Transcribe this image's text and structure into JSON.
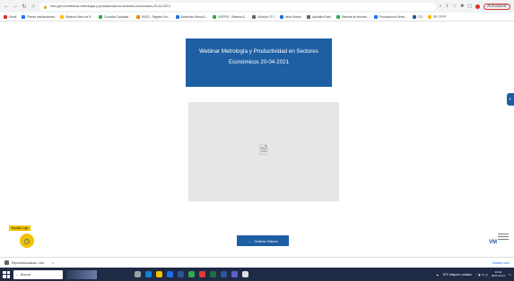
{
  "browser": {
    "url": "lmm.gob.mx/webinar-metrologia-y-productividad-en-sectores-economicos-20-04-2021/",
    "update_label": "Actualizar"
  },
  "bookmarks": [
    {
      "label": "Gmail",
      "color": "#d93025"
    },
    {
      "label": "Planes Institucionales",
      "color": "#1a73e8"
    },
    {
      "label": "Sistema Único de R...",
      "color": "#fbbc04"
    },
    {
      "label": "Consulta Ciudadan...",
      "color": "#34a853"
    },
    {
      "label": "RUES - Registro Úni...",
      "color": "#ea8600"
    },
    {
      "label": "Academia Virtual A...",
      "color": "#1a73e8"
    },
    {
      "label": "SISPRO - Sistema &...",
      "color": "#34a853"
    },
    {
      "label": "Solución TI 2",
      "color": "#5f6368"
    },
    {
      "label": "Inicio Sesión",
      "color": "#1a73e8"
    },
    {
      "label": "Aplicativo Sabi",
      "color": "#5f6368"
    },
    {
      "label": "Sistema de Informa...",
      "color": "#34a853"
    },
    {
      "label": "Procuraduría Gener...",
      "color": "#1a73e8"
    },
    {
      "label": "CCI",
      "color": "#1e5fa3"
    },
    {
      "label": "SP CPYP",
      "color": "#fbbc04"
    }
  ],
  "title": {
    "line1": "Webinar Metrología y Productividad en Sectores",
    "line2": "Económicos 20-04-2021"
  },
  "gallery_button": {
    "arrow": "←",
    "label": "Galeria Videos"
  },
  "survey": {
    "label": "Escribir Logo"
  },
  "logo": {
    "text": "VM"
  },
  "download": {
    "filename": "ReporteActualizac...xlsx",
    "show_all": "Mostrar todo"
  },
  "taskbar": {
    "search_placeholder": "Buscar",
    "weather": "19°C Mayorm. nublado",
    "time": "10:42",
    "date": "2021-05-11"
  },
  "colors": {
    "accent": "#1e5fa3",
    "survey": "#f2c200"
  }
}
